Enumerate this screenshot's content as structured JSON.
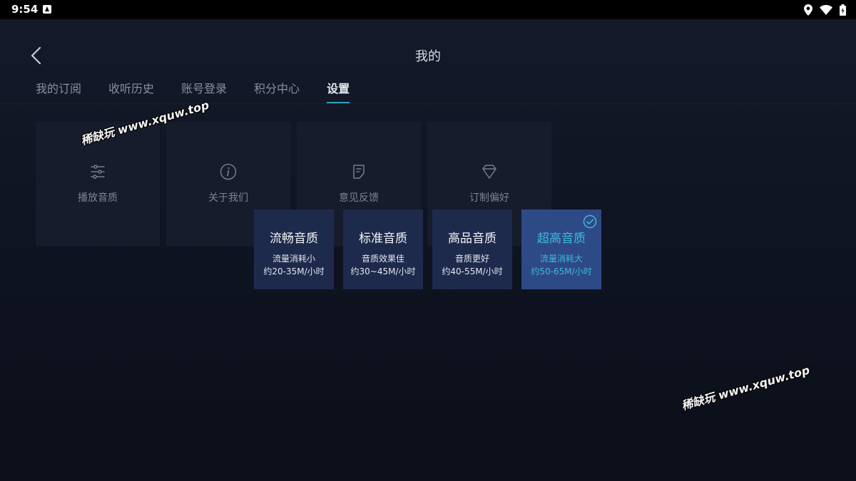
{
  "status_bar": {
    "time": "9:54",
    "icons": [
      "app-notification-icon",
      "location-icon",
      "wifi-icon",
      "battery-icon"
    ]
  },
  "header": {
    "back_icon": "back-chevron-icon",
    "title": "我的"
  },
  "tabs": [
    {
      "label": "我的订阅",
      "active": false
    },
    {
      "label": "收听历史",
      "active": false
    },
    {
      "label": "账号登录",
      "active": false
    },
    {
      "label": "积分中心",
      "active": false
    },
    {
      "label": "设置",
      "active": true
    }
  ],
  "settings_tiles": [
    {
      "label": "播放音质",
      "icon": "sliders-icon"
    },
    {
      "label": "关于我们",
      "icon": "info-icon"
    },
    {
      "label": "意见反馈",
      "icon": "feedback-icon"
    },
    {
      "label": "订制偏好",
      "icon": "diamond-icon"
    }
  ],
  "quality_options": [
    {
      "name": "流畅音质",
      "desc1": "流量消耗小",
      "desc2": "约20-35M/小时",
      "selected": false
    },
    {
      "name": "标准音质",
      "desc1": "音质效果佳",
      "desc2": "约30~45M/小时",
      "selected": false
    },
    {
      "name": "高品音质",
      "desc1": "音质更好",
      "desc2": "约40-55M/小时",
      "selected": false
    },
    {
      "name": "超高音质",
      "desc1": "流量消耗大",
      "desc2": "约50-65M/小时",
      "selected": true
    }
  ],
  "watermarks": [
    "稀缺玩 www.xquw.top",
    "稀缺玩 www.xquw.top"
  ],
  "colors": {
    "accent": "#3fb7de",
    "tab_underline": "#2aa0c4",
    "card_bg": "#1e2a4c",
    "card_selected_bg": "#2e4a86",
    "tile_bg": "#161c2b"
  }
}
